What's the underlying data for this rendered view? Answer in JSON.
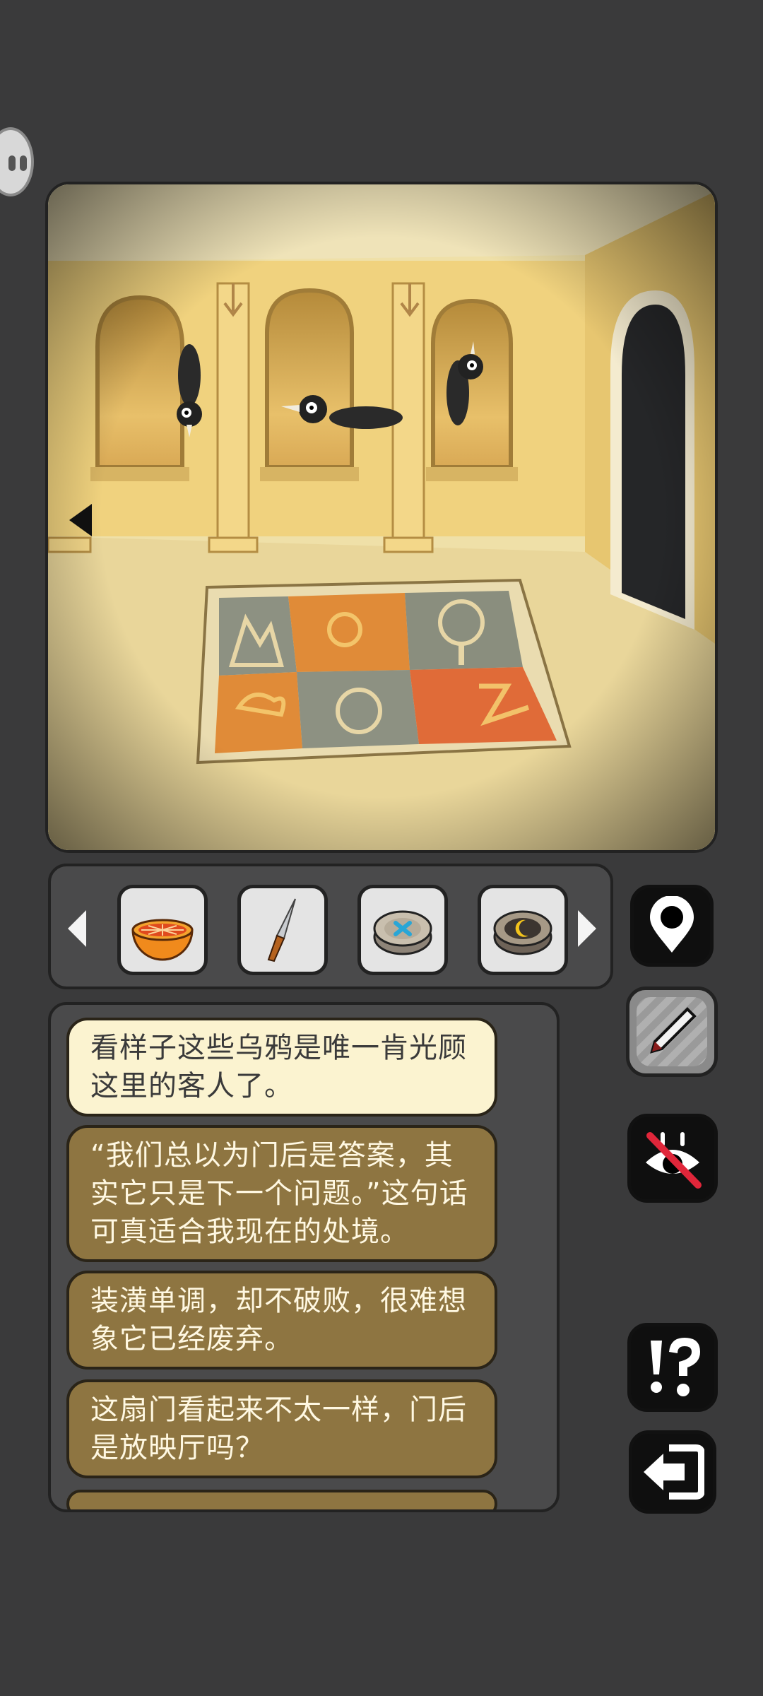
{
  "inventory": {
    "items": [
      {
        "name": "orange-icon"
      },
      {
        "name": "knife-icon"
      },
      {
        "name": "blue-cross-disc-icon"
      },
      {
        "name": "moon-disc-icon"
      }
    ]
  },
  "side_buttons": [
    "map-pin-icon",
    "pencil-icon",
    "hidden-eye-icon",
    "hint-icon",
    "exit-icon"
  ],
  "dialog": {
    "lines": [
      "看样子这些乌鸦是唯一肯光顾这里的客人了。",
      "“我们总以为门后是答案，其实它只是下一个问题。”这句话可真适合我现在的处境。",
      "装潢单调，却不破败，很难想象它已经废弃。",
      "这扇门看起来不太一样，门后是放映厅吗？"
    ]
  },
  "colors": {
    "background": "#3a3a3b",
    "panel": "#4a4a4b",
    "bubble": "#8e7541",
    "bubble_active": "#fbf3d0"
  }
}
